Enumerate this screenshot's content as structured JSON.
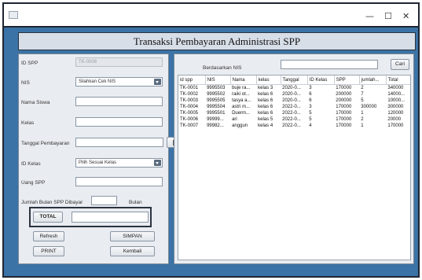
{
  "window": {
    "minimize_glyph": "—",
    "maximize_glyph": "☐",
    "close_glyph": "✕"
  },
  "header": {
    "title": "Transaksi Pembayaran Administrasi SPP"
  },
  "form": {
    "id_spp": {
      "label": "ID SPP",
      "value": "TK-0008"
    },
    "nis": {
      "label": "NIS",
      "selected": "Silahkan Cek NIS"
    },
    "nama_siswa": {
      "label": "Nama Siswa",
      "value": ""
    },
    "kelas": {
      "label": "Kelas",
      "value": ""
    },
    "tanggal": {
      "label": "Tanggal Pembayaran",
      "value": "",
      "button_icon": "calendar-icon"
    },
    "id_kelas": {
      "label": "ID Kelas",
      "selected": "Pilih Sesuai Kelas"
    },
    "uang_spp": {
      "label": "Uang SPP",
      "value": ""
    },
    "jumlah_bulan": {
      "label": "Jumlah Bulan SPP Dibayar",
      "value": "",
      "unit": "Bulan"
    },
    "total": {
      "label": "TOTAL",
      "value": ""
    },
    "buttons": {
      "refresh": "Refresh",
      "simpan": "SIMPAN",
      "print": "PRINT",
      "kembali": "Kembali"
    }
  },
  "search": {
    "label": "Berdasarkan NIS",
    "value": "",
    "button": "Cari"
  },
  "table": {
    "columns": [
      "id spp",
      "NIS",
      "Nama",
      "kelas",
      "Tanggal",
      "ID Kelas",
      "SPP",
      "jumlah...",
      "Total"
    ],
    "rows": [
      [
        "TK-0001",
        "9995503",
        "buje ra...",
        "kelas 3",
        "2020-0...",
        "3",
        "170000",
        "2",
        "340000"
      ],
      [
        "TK-0002",
        "9995502",
        "raiki ot...",
        "kelas 6",
        "2020-0...",
        "6",
        "200000",
        "7",
        "14000..."
      ],
      [
        "TK-0003",
        "9995505",
        "tasya a...",
        "kelas 6",
        "2020-0...",
        "6",
        "200000",
        "5",
        "10000..."
      ],
      [
        "TK-0004",
        "9995504",
        "astri m...",
        "kelas 6",
        "2022-0...",
        "3",
        "170000",
        "300000",
        "300000"
      ],
      [
        "TK-0005",
        "9995501",
        "Duerm...",
        "kelas 6",
        "2022-0...",
        "5",
        "170000",
        "1",
        "120000"
      ],
      [
        "TK-0006",
        "99999...",
        "ari",
        "kelas 5",
        "2022-0...",
        "5",
        "170000",
        "2",
        "20000"
      ],
      [
        "TK-0007",
        "99982...",
        "anggun",
        "kelas 4",
        "2022-0...",
        "4",
        "170000",
        "1",
        "170000"
      ]
    ]
  }
}
